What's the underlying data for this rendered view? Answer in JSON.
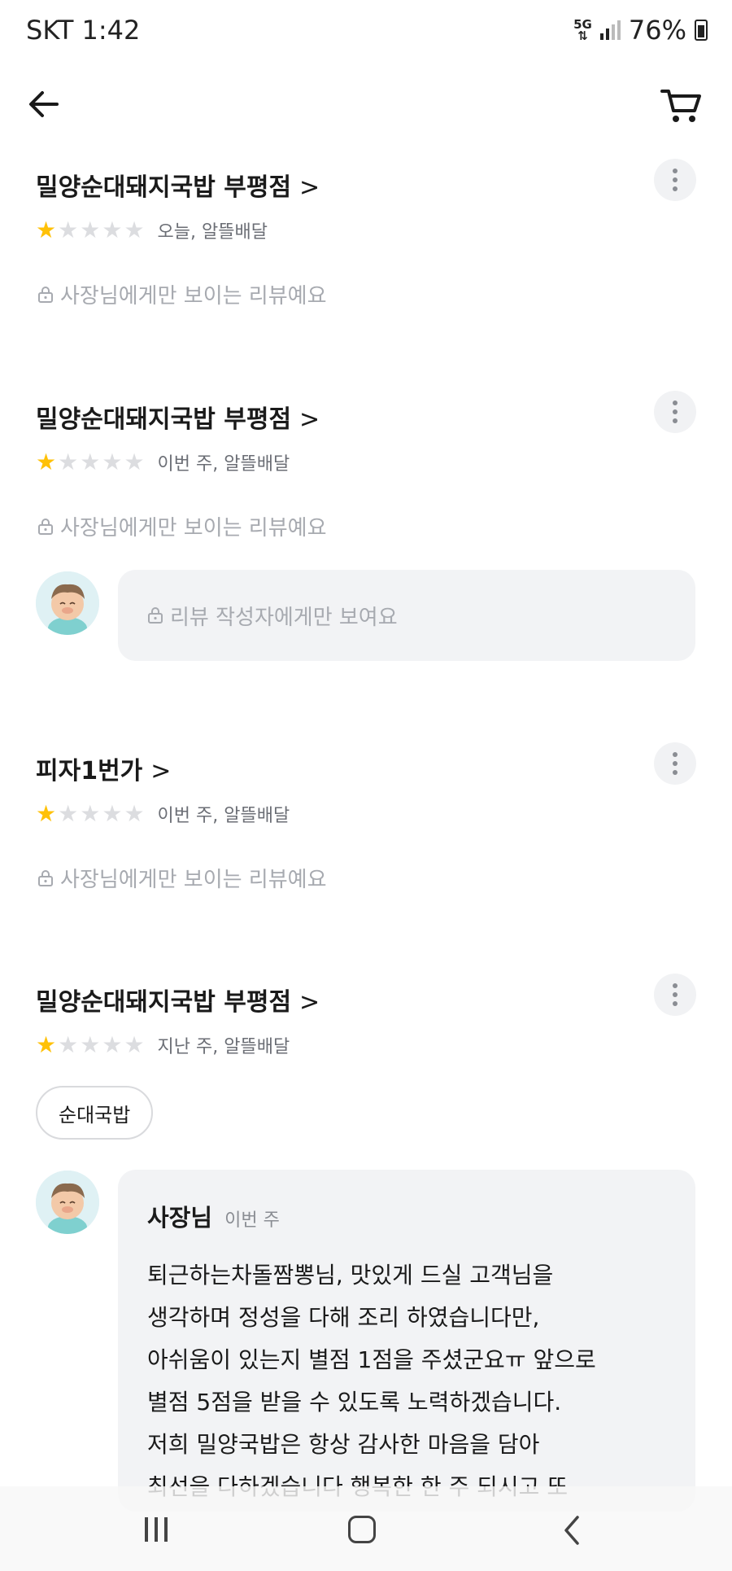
{
  "status_bar": {
    "carrier_time": "SKT 1:42",
    "network": "5G",
    "battery": "76%"
  },
  "header": {
    "back_icon": "arrow-left-icon",
    "cart_icon": "cart-icon"
  },
  "reviews": [
    {
      "store": "밀양순대돼지국밥 부평점",
      "chevron": ">",
      "rating": 1,
      "meta": "오늘, 알뜰배달",
      "private_note": "사장님에게만 보이는 리뷰예요"
    },
    {
      "store": "밀양순대돼지국밥 부평점",
      "chevron": ">",
      "rating": 1,
      "meta": "이번 주, 알뜰배달",
      "private_note": "사장님에게만 보이는 리뷰예요",
      "reply_private": "리뷰 작성자에게만 보여요"
    },
    {
      "store": "피자1번가",
      "chevron": ">",
      "rating": 1,
      "meta": "이번 주, 알뜰배달",
      "private_note": "사장님에게만 보이는 리뷰예요"
    },
    {
      "store": "밀양순대돼지국밥 부평점",
      "chevron": ">",
      "rating": 1,
      "meta": "지난 주, 알뜰배달",
      "tag": "순대국밥",
      "reply": {
        "author": "사장님",
        "time": "이번 주",
        "text": "퇴근하는차돌짬뽕님, 맛있게 드실 고객님을\n생각하며 정성을 다해 조리 하였습니다만,\n아쉬움이 있는지 별점 1점을 주셨군요ㅠ 앞으로\n별점 5점을 받을 수 있도록 노력하겠습니다.\n저희 밀양국밥은 항상 감사한 마음을 담아\n최선을 다하겠습니다 행복한 한 주 되시고 또\n들려주세요 감사합니다"
      }
    }
  ],
  "colors": {
    "star_on": "#ffc107",
    "star_off": "#dcdde0",
    "bubble_bg": "#f2f3f5",
    "muted_text": "#a7aab0"
  },
  "nav_bar": {
    "recent_icon": "recent-apps-icon",
    "home_icon": "home-icon",
    "back_icon": "nav-back-icon"
  }
}
